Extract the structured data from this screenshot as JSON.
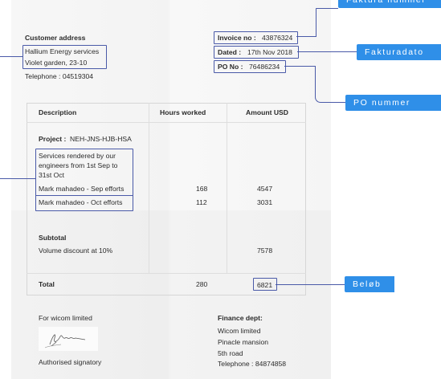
{
  "labels": {
    "invoice_number": "Faktura nummer",
    "invoice_date": "Fakturadato",
    "po_number": "PO nummer",
    "amount": "Beløb"
  },
  "customer": {
    "heading": "Customer address",
    "name": "Hallium Energy services",
    "street": "Violet garden, 23-10",
    "telephone": "Telephone : 04519304"
  },
  "invoice": {
    "number_label": "Invoice no :",
    "number": "43876324",
    "date_label": "Dated :",
    "date": "17th Nov 2018",
    "po_label": "PO No :",
    "po": "76486234"
  },
  "table": {
    "headers": [
      "Description",
      "Hours worked",
      "Amount USD"
    ],
    "project_label": "Project :",
    "project": "NEH-JNS-HJB-HSA",
    "service_lines": [
      "Services rendered by our",
      "engineers from 1st Sep to",
      "31st Oct"
    ],
    "rows": [
      {
        "desc": "Mark mahadeo - Sep efforts",
        "hours": "168",
        "amount": "4547"
      },
      {
        "desc": "Mark mahadeo - Oct efforts",
        "hours": "112",
        "amount": "3031"
      }
    ],
    "subtotal_label": "Subtotal",
    "discount_label": "Volume discount at 10%",
    "discount_amount": "7578",
    "total_label": "Total",
    "total_hours": "280",
    "total_amount": "6821"
  },
  "footer": {
    "company": "For wicom limited",
    "signatory": "Authorised signatory",
    "finance_heading": "Finance dept:",
    "finance_lines": [
      "Wicom limited",
      "Pinacle mansion",
      "5th road",
      "Telephone : 84874858"
    ]
  },
  "colors": {
    "tag_background": "#2f8fe8",
    "highlight_border": "#4a5aa8"
  }
}
